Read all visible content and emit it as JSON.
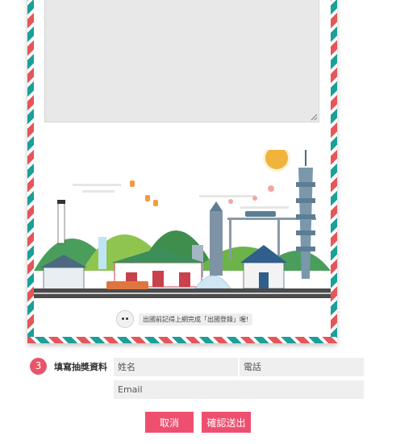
{
  "envelope": {
    "reminder_text": "出國前記得上網完成「出國登錄」喔!",
    "colors": {
      "stripe_red": "#e45659",
      "stripe_teal": "#1b9f98"
    }
  },
  "form": {
    "step_number": "3",
    "step_label": "填寫抽獎資料",
    "name_placeholder": "姓名",
    "phone_placeholder": "電話",
    "email_placeholder": "Email"
  },
  "actions": {
    "cancel_label": "取消",
    "submit_label": "確認送出",
    "accent_color": "#ef4f6f"
  }
}
